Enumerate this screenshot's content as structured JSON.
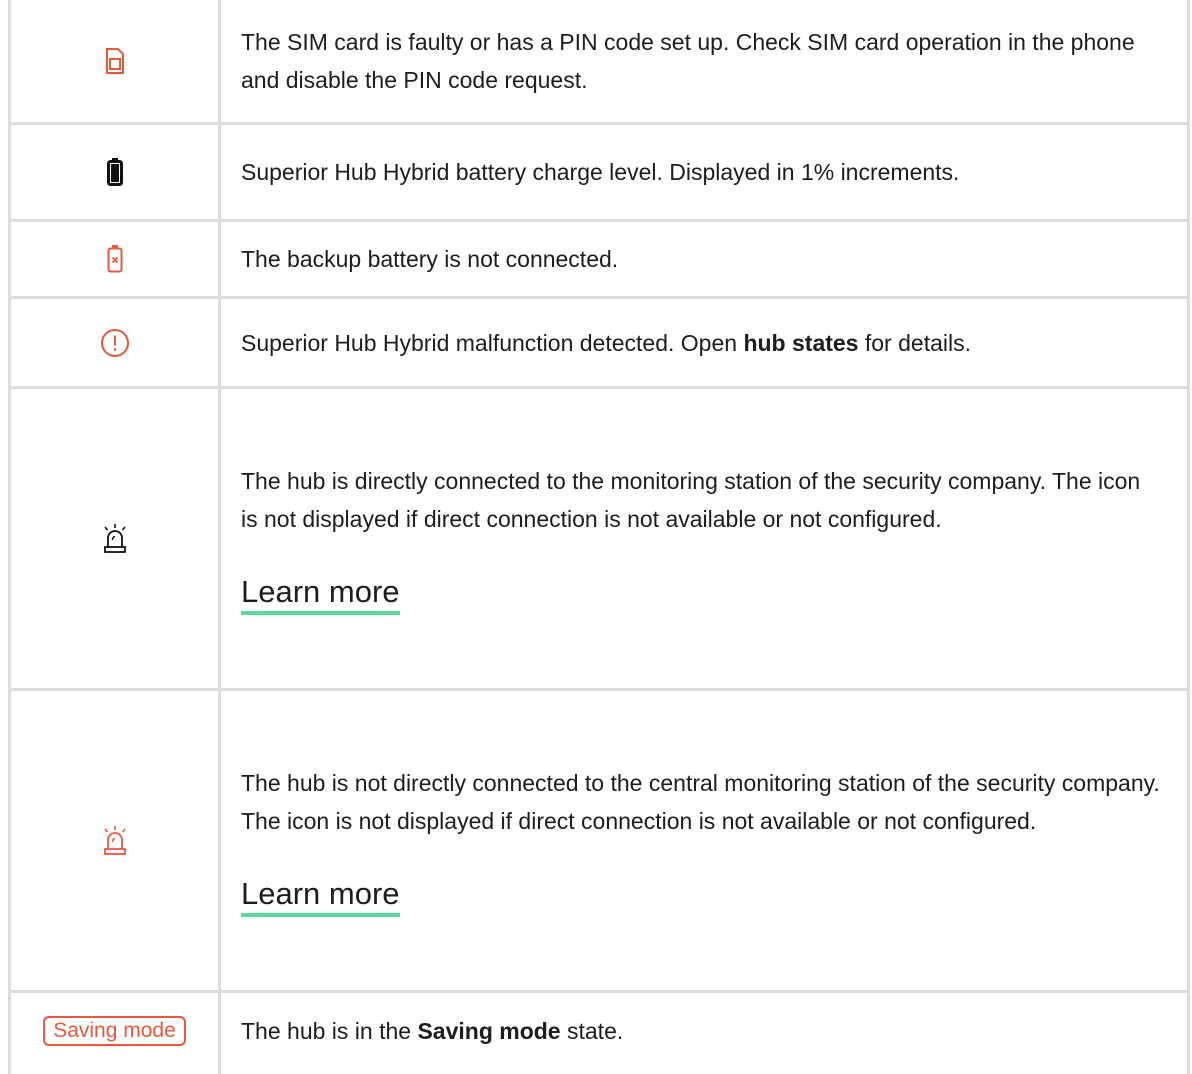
{
  "colors": {
    "alert": "#e9573f",
    "link_underline": "#5ed6a0",
    "grid": "#dcdcdc",
    "text": "#1d1d1d"
  },
  "rows": [
    {
      "icon": "sim-card-icon",
      "text": "The SIM card is faulty or has a PIN code set up. Check SIM card operation in the phone and disable the PIN code request."
    },
    {
      "icon": "battery-icon",
      "text": "Superior Hub Hybrid battery charge level. Displayed in 1% increments."
    },
    {
      "icon": "battery-disconnected-icon",
      "text": "The backup battery is not connected."
    },
    {
      "icon": "malfunction-icon",
      "text_before": "Superior Hub Hybrid malfunction detected. Open ",
      "bold": "hub states",
      "text_after": " for details."
    },
    {
      "icon": "siren-connected-icon",
      "text": "The hub is directly connected to the monitoring station of the security company. The icon is not displayed if direct connection is not available or not configured.",
      "link": "Learn more"
    },
    {
      "icon": "siren-disconnected-icon",
      "text": "The hub is not directly connected to the central monitoring station of the security company. The icon is not displayed if direct connection is not available or not configured.",
      "link": "Learn more"
    },
    {
      "badge": "Saving mode",
      "text_before": "The hub is in the ",
      "bold": "Saving mode",
      "text_after": " state."
    }
  ]
}
